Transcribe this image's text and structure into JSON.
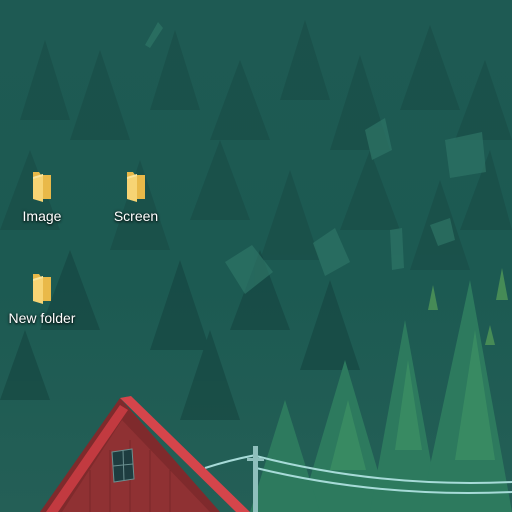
{
  "desktop": {
    "wallpaper": {
      "theme": "forest-cabin",
      "colors": {
        "sky": "#1f5a52",
        "forest_dark": "#163f3b",
        "forest_mid": "#2a6e5f",
        "roof": "#d7434a",
        "wall": "#8d2f30",
        "wire": "#a5d8d6"
      }
    },
    "icons": [
      {
        "label": "Image",
        "icon": "folder-icon"
      },
      {
        "label": "Screen",
        "icon": "folder-icon"
      },
      {
        "label": "New folder",
        "icon": "folder-icon"
      }
    ]
  }
}
